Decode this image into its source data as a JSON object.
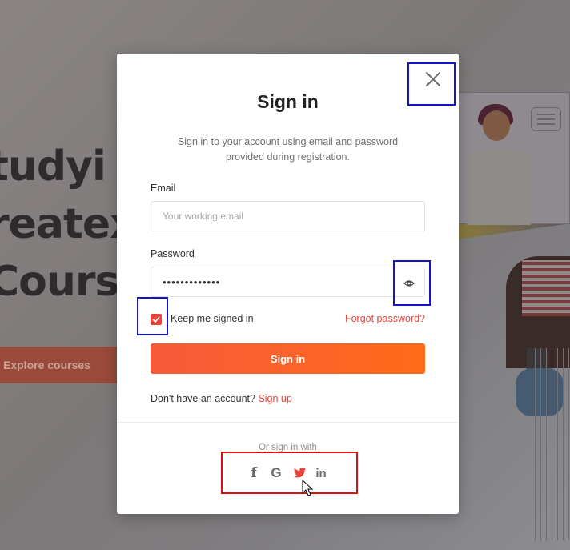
{
  "background": {
    "hero_lines": [
      "tudyi",
      "reatex",
      "Cours"
    ],
    "explore_button": "Explore courses"
  },
  "modal": {
    "title": "Sign in",
    "subtitle": "Sign in to your account using email and password provided during registration.",
    "email": {
      "label": "Email",
      "placeholder": "Your working email",
      "value": ""
    },
    "password": {
      "label": "Password",
      "masked_value": "•••••••••••••"
    },
    "keep_signed_in": {
      "label": "Keep me signed in",
      "checked": true
    },
    "forgot_password": "Forgot password?",
    "submit_label": "Sign in",
    "no_account_text": "Don't have an account?",
    "signup_link": "Sign up",
    "or_sign_in_with": "Or sign in with",
    "social": [
      {
        "name": "facebook-icon",
        "glyph": "f"
      },
      {
        "name": "google-icon",
        "glyph": "G"
      },
      {
        "name": "twitter-icon",
        "glyph": ""
      },
      {
        "name": "linkedin-icon",
        "glyph": "in"
      }
    ]
  },
  "colors": {
    "accent": "#e8423a",
    "button_gradient_start": "#f65a3b",
    "button_gradient_end": "#fe6c1a",
    "annotation_blue": "#1313c8",
    "annotation_red": "#e01010"
  }
}
